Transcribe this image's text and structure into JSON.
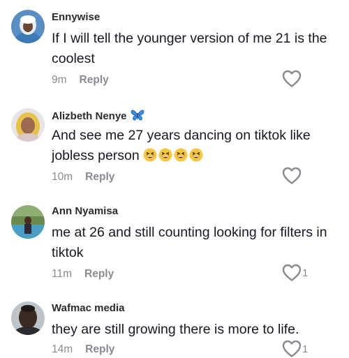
{
  "comments": [
    {
      "username": "Ennywise",
      "text": "If I will tell the younger version of me 21 is the coolest",
      "time": "9m",
      "reply_label": "Reply",
      "like_count": "",
      "liked_icon": "heart-outline-icon"
    },
    {
      "username": "Alizbeth Nenye",
      "username_badge": "butterfly-emoji",
      "text": "And see me 27 years dancing on tiktok like jobless person",
      "text_emojis": [
        "grinning-squinting-face-emoji",
        "grinning-squinting-face-emoji",
        "grinning-squinting-face-emoji",
        "grinning-squinting-face-emoji"
      ],
      "time": "10m",
      "reply_label": "Reply",
      "like_count": "",
      "liked_icon": "heart-outline-icon"
    },
    {
      "username": "Ann Nyamisa",
      "text": "me at 26 and still counting looking for filters in tiktok",
      "time": "11m",
      "reply_label": "Reply",
      "like_count": "1",
      "liked_icon": "heart-outline-icon"
    },
    {
      "username": "Wafmac media",
      "text": "they are still growing there is more to life.",
      "time": "14m",
      "reply_label": "Reply",
      "like_count": "1",
      "liked_icon": "heart-outline-icon"
    }
  ],
  "colors": {
    "username": "#2b2b2b",
    "text": "#161823",
    "meta": "#8a8b91",
    "heart": "#8a8b91"
  }
}
